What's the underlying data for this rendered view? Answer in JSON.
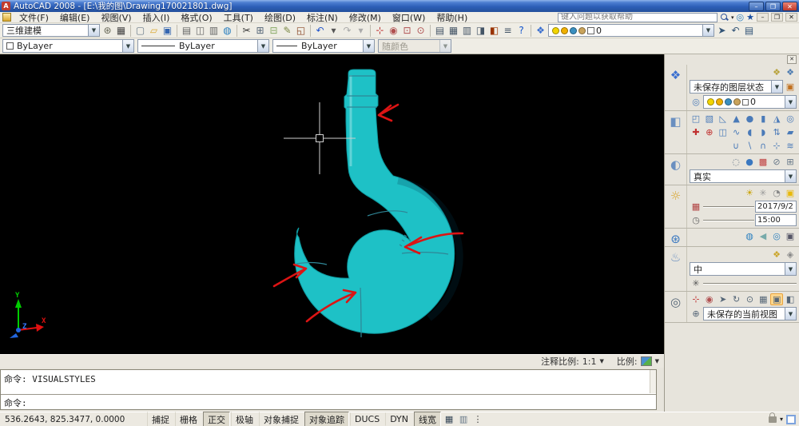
{
  "window": {
    "title": "AutoCAD 2008 - [E:\\我的图\\Drawing170021801.dwg]"
  },
  "titlebar": {
    "buttons": [
      {
        "n": "minimize-button",
        "t": "–"
      },
      {
        "n": "maximize-button",
        "t": "❐"
      },
      {
        "n": "close-button",
        "t": "✕",
        "cls": "close"
      }
    ]
  },
  "menu": {
    "items": [
      {
        "n": "menu-file",
        "t": "文件(F)"
      },
      {
        "n": "menu-edit",
        "t": "编辑(E)"
      },
      {
        "n": "menu-view",
        "t": "视图(V)"
      },
      {
        "n": "menu-insert",
        "t": "插入(I)"
      },
      {
        "n": "menu-format",
        "t": "格式(O)"
      },
      {
        "n": "menu-tools",
        "t": "工具(T)"
      },
      {
        "n": "menu-draw",
        "t": "绘图(D)"
      },
      {
        "n": "menu-dimension",
        "t": "标注(N)"
      },
      {
        "n": "menu-modify",
        "t": "修改(M)"
      },
      {
        "n": "menu-window",
        "t": "窗口(W)"
      },
      {
        "n": "menu-help",
        "t": "帮助(H)"
      }
    ],
    "search_placeholder": "键入问题以获取帮助",
    "win_buttons": [
      {
        "n": "doc-minimize-button",
        "t": "–"
      },
      {
        "n": "doc-restore-button",
        "t": "❐"
      },
      {
        "n": "doc-close-button",
        "t": "✕"
      }
    ]
  },
  "toolbar": {
    "workspace_value": "三维建模",
    "icons": [
      {
        "n": "workspace-settings-icon",
        "t": "⊛",
        "c": "#666655"
      },
      {
        "n": "display-config-icon",
        "t": "▦",
        "c": "#444444"
      },
      {
        "sep": true
      },
      {
        "n": "new-file-icon",
        "t": "▢",
        "c": "#667788"
      },
      {
        "n": "open-file-icon",
        "t": "▱",
        "c": "#d9a62e"
      },
      {
        "n": "save-icon",
        "t": "▣",
        "c": "#3566b0"
      },
      {
        "sep": true
      },
      {
        "n": "plot-icon",
        "t": "▤",
        "c": "#666666"
      },
      {
        "n": "plot-preview-icon",
        "t": "◫",
        "c": "#666666"
      },
      {
        "n": "publish-icon",
        "t": "▥",
        "c": "#666666"
      },
      {
        "n": "3ddwf-icon",
        "t": "◍",
        "c": "#2a7fbf"
      },
      {
        "sep": true
      },
      {
        "n": "cut-icon",
        "t": "✂",
        "c": "#333333"
      },
      {
        "n": "copy-icon",
        "t": "⊞",
        "c": "#556677"
      },
      {
        "n": "paste-icon",
        "t": "⊟",
        "c": "#88aa66"
      },
      {
        "n": "match-properties-icon",
        "t": "✎",
        "c": "#7a8844"
      },
      {
        "n": "block-editor-icon",
        "t": "◱",
        "c": "#884422"
      },
      {
        "sep": true
      },
      {
        "n": "undo-icon",
        "t": "↶",
        "c": "#2255cc"
      },
      {
        "n": "undo-dropdown-icon",
        "t": "▾",
        "c": "#555555"
      },
      {
        "n": "redo-icon",
        "t": "↷",
        "c": "#aaaaaa"
      },
      {
        "n": "redo-dropdown-icon",
        "t": "▾",
        "c": "#aaaaaa"
      },
      {
        "sep": true
      },
      {
        "n": "pan-realtime-icon",
        "t": "⊹",
        "c": "#c03030"
      },
      {
        "n": "zoom-realtime-icon",
        "t": "◉",
        "c": "#b05050"
      },
      {
        "n": "zoom-window-icon",
        "t": "⊡",
        "c": "#b05050"
      },
      {
        "n": "zoom-previous-icon",
        "t": "⊙",
        "c": "#b05050"
      },
      {
        "sep": true
      },
      {
        "n": "properties-palette-icon",
        "t": "▤",
        "c": "#445566"
      },
      {
        "n": "designcenter-icon",
        "t": "▦",
        "c": "#445566"
      },
      {
        "n": "tool-palettes-icon",
        "t": "▥",
        "c": "#445566"
      },
      {
        "n": "sheet-set-manager-icon",
        "t": "◨",
        "c": "#445566"
      },
      {
        "n": "markup-set-manager-icon",
        "t": "◧",
        "c": "#993300"
      },
      {
        "n": "quickcalc-icon",
        "t": "≡",
        "c": "#445566"
      },
      {
        "n": "help-icon",
        "t": "?",
        "c": "#1155cc"
      },
      {
        "sep": true
      },
      {
        "n": "layers-manager-icon",
        "t": "❖",
        "c": "#3a6fd0"
      }
    ],
    "layer_icons": [
      {
        "n": "layer-on-bulb-icon",
        "bg": "#f2d500"
      },
      {
        "n": "layer-sun-icon",
        "bg": "#f0b000"
      },
      {
        "n": "layer-freeze-icon",
        "bg": "#3a8fc0"
      },
      {
        "n": "layer-lock-icon",
        "bg": "#c9a35b"
      }
    ],
    "layer_value": "0",
    "right_icons": [
      {
        "n": "make-layer-current-icon",
        "t": "➤",
        "c": "#335577"
      },
      {
        "n": "layer-previous-icon",
        "t": "↶",
        "c": "#335577"
      },
      {
        "n": "layer-properties-icon",
        "t": "▤",
        "c": "#335577"
      }
    ]
  },
  "props_bar": {
    "color_value": "ByLayer",
    "linetype_value": "ByLayer",
    "lineweight_value": "ByLayer",
    "plotstyle_value": "随颜色"
  },
  "colors": {
    "hook": "#1ec1c6",
    "hook_edge": "#0d9aa0",
    "seam": "#2f8696",
    "annotation": "#dc1414",
    "canvas_bg": "#000000"
  },
  "canvas": {
    "ucs": {
      "x": "X",
      "y": "Y",
      "z": "Z"
    }
  },
  "tray": {
    "annot_label": "注释比例:",
    "annot_value": "1:1",
    "scale_label": "比例:"
  },
  "dashboard": {
    "close_label": "✕",
    "layers": {
      "top_icons": [
        {
          "n": "layer-states-manager-icon",
          "t": "❖",
          "c": "#b8a23a"
        },
        {
          "n": "layer-isolate-icon",
          "t": "❖",
          "c": "#4a7ab0"
        }
      ],
      "state_value": "未保存的图层状态",
      "row_icon": "◎",
      "layer_value": "0"
    },
    "make": {
      "row1": [
        {
          "n": "polysolid-icon",
          "t": "◰"
        },
        {
          "n": "box-icon",
          "t": "▧"
        },
        {
          "n": "wedge-icon",
          "t": "◺"
        },
        {
          "n": "cone-icon",
          "t": "▲"
        },
        {
          "n": "sphere-icon",
          "t": "●"
        },
        {
          "n": "cylinder-icon",
          "t": "▮"
        },
        {
          "n": "pyramid-icon",
          "t": "◮"
        },
        {
          "n": "torus-icon",
          "t": "◎"
        }
      ],
      "row2": [
        {
          "n": "ucs-axes-icon",
          "t": "✚",
          "c": "#c03030"
        },
        {
          "n": "orbit-axes-icon",
          "t": "⊕",
          "c": "#c03030"
        },
        {
          "n": "extrude-icon",
          "t": "◫"
        },
        {
          "n": "sweep-icon",
          "t": "∿"
        },
        {
          "n": "revolve-icon",
          "t": "◖"
        },
        {
          "n": "loft-icon",
          "t": "◗"
        },
        {
          "n": "presspull-icon",
          "t": "⇅"
        },
        {
          "n": "slice-icon",
          "t": "▰"
        }
      ],
      "row3": [
        {
          "n": "union-icon",
          "t": "∪"
        },
        {
          "n": "subtract-icon",
          "t": "∖"
        },
        {
          "n": "intersect-icon",
          "t": "∩"
        },
        {
          "n": "3dmove-icon",
          "t": "⊹"
        },
        {
          "n": "3dalign-icon",
          "t": "≋"
        }
      ]
    },
    "visual": {
      "icons": [
        {
          "n": "wireframe-style-icon",
          "t": "◌",
          "c": "#667788"
        },
        {
          "n": "realistic-style-icon",
          "t": "●",
          "c": "#3a78c0"
        },
        {
          "n": "face-color-icon",
          "t": "▩",
          "c": "#c04040"
        },
        {
          "n": "xray-mode-icon",
          "t": "⊘",
          "c": "#667788"
        },
        {
          "n": "edge-mode-icon",
          "t": "⊞",
          "c": "#667788"
        }
      ],
      "value": "真实"
    },
    "light": {
      "icons": [
        {
          "n": "new-point-light-icon",
          "t": "☀",
          "c": "#caa50a"
        },
        {
          "n": "new-spotlight-icon",
          "t": "✳",
          "c": "#999999"
        },
        {
          "n": "geographic-location-icon",
          "t": "◔",
          "c": "#888888"
        },
        {
          "n": "sun-status-icon",
          "t": "▣",
          "c": "#e8b90a"
        }
      ],
      "date_value": "2017/9/2",
      "time_value": "15:00"
    },
    "render_row": {
      "icons": [
        {
          "n": "render-environment-icon",
          "t": "◍",
          "c": "#2a7fbf"
        },
        {
          "n": "fog-icon",
          "t": "◀",
          "c": "#77aaaa"
        },
        {
          "n": "render-online-icon",
          "t": "◎",
          "c": "#2a7fbf"
        },
        {
          "n": "render-window-icon",
          "t": "▣",
          "c": "#555566"
        }
      ]
    },
    "materials": {
      "icons": [
        {
          "n": "materials-editor-icon",
          "t": "❖",
          "c": "#caa52a"
        },
        {
          "n": "render-presets-icon",
          "t": "◈",
          "c": "#888888"
        }
      ],
      "quality_value": "中"
    },
    "navigate": {
      "icons": [
        {
          "n": "pan-icon",
          "t": "⊹",
          "c": "#c03030"
        },
        {
          "n": "zoom-icon",
          "t": "◉",
          "c": "#b05050"
        },
        {
          "n": "walk-icon",
          "t": "➤",
          "c": "#556677"
        },
        {
          "n": "orbit-icon",
          "t": "↻",
          "c": "#556677"
        },
        {
          "n": "swivel-icon",
          "t": "⊙",
          "c": "#556677"
        },
        {
          "n": "camera-icon",
          "t": "▦",
          "c": "#556677"
        },
        {
          "n": "perspective-icon",
          "t": "▣",
          "c": "#556677",
          "hl": true
        },
        {
          "n": "parallel-icon",
          "t": "◧",
          "c": "#556677"
        }
      ],
      "view_value": "未保存的当前视图"
    }
  },
  "command": {
    "line1": "命令: VISUALSTYLES",
    "line2": "命令:"
  },
  "status": {
    "coords": "536.2643, 825.3477, 0.0000",
    "toggles": [
      {
        "n": "toggle-snap",
        "t": "捕捉"
      },
      {
        "n": "toggle-grid",
        "t": "栅格"
      },
      {
        "n": "toggle-ortho",
        "t": "正交",
        "on": true
      },
      {
        "n": "toggle-polar",
        "t": "极轴"
      },
      {
        "n": "toggle-osnap",
        "t": "对象捕捉"
      },
      {
        "n": "toggle-otrack",
        "t": "对象追踪",
        "on": true
      },
      {
        "n": "toggle-ducs",
        "t": "DUCS"
      },
      {
        "n": "toggle-dyn",
        "t": "DYN"
      },
      {
        "n": "toggle-lwt",
        "t": "线宽",
        "on": true
      }
    ],
    "mode_icons": [
      {
        "n": "model-space-icon",
        "t": "▦",
        "c": "#334455"
      },
      {
        "n": "layout-icon",
        "t": "▥",
        "c": "#667788"
      },
      {
        "n": "quickview-icon",
        "t": "⋮",
        "c": "#333333"
      }
    ],
    "tray_arrow": "▾"
  }
}
